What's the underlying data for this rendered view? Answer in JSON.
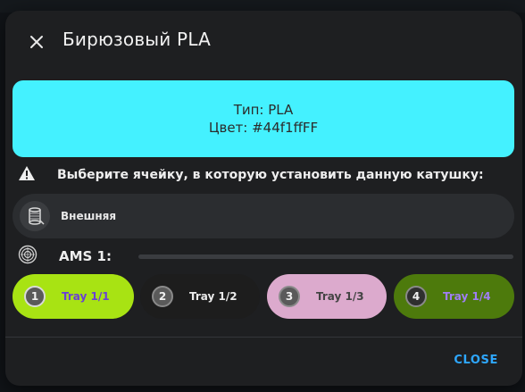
{
  "dialog": {
    "title": "Бирюзовый PLA",
    "close_icon": "close-icon"
  },
  "filament": {
    "type_line": "Тип: PLA",
    "color_line": "Цвет: #44f1ffFF",
    "color": "#44f1ff"
  },
  "prompt": {
    "icon": "warning-icon",
    "text": "Выберите ячейку, в которую установить данную катушку:"
  },
  "external": {
    "icon": "spool-icon",
    "label": "Внешняя"
  },
  "ams": {
    "icon": "ams-icon",
    "label": "AMS 1:"
  },
  "trays": [
    {
      "number": "1",
      "label": "Tray 1/1",
      "bg": "#a8e313",
      "text_color": "#6a3fd6",
      "num_bg": "#5a5a5a",
      "selected": true
    },
    {
      "number": "2",
      "label": "Tray 1/2",
      "bg": "#1d1d1d",
      "text_color": "#eaeaea",
      "num_bg": "#5a5a5a",
      "selected": false
    },
    {
      "number": "3",
      "label": "Tray 1/3",
      "bg": "#dcaacd",
      "text_color": "#444444",
      "num_bg": "#5a5a5a",
      "selected": false
    },
    {
      "number": "4",
      "label": "Tray 1/4",
      "bg": "#4d7a0c",
      "text_color": "#a07ef5",
      "num_bg": "#2f2f2f",
      "selected": false
    }
  ],
  "footer": {
    "close_label": "CLOSE",
    "accent": "#2ea7ff"
  }
}
